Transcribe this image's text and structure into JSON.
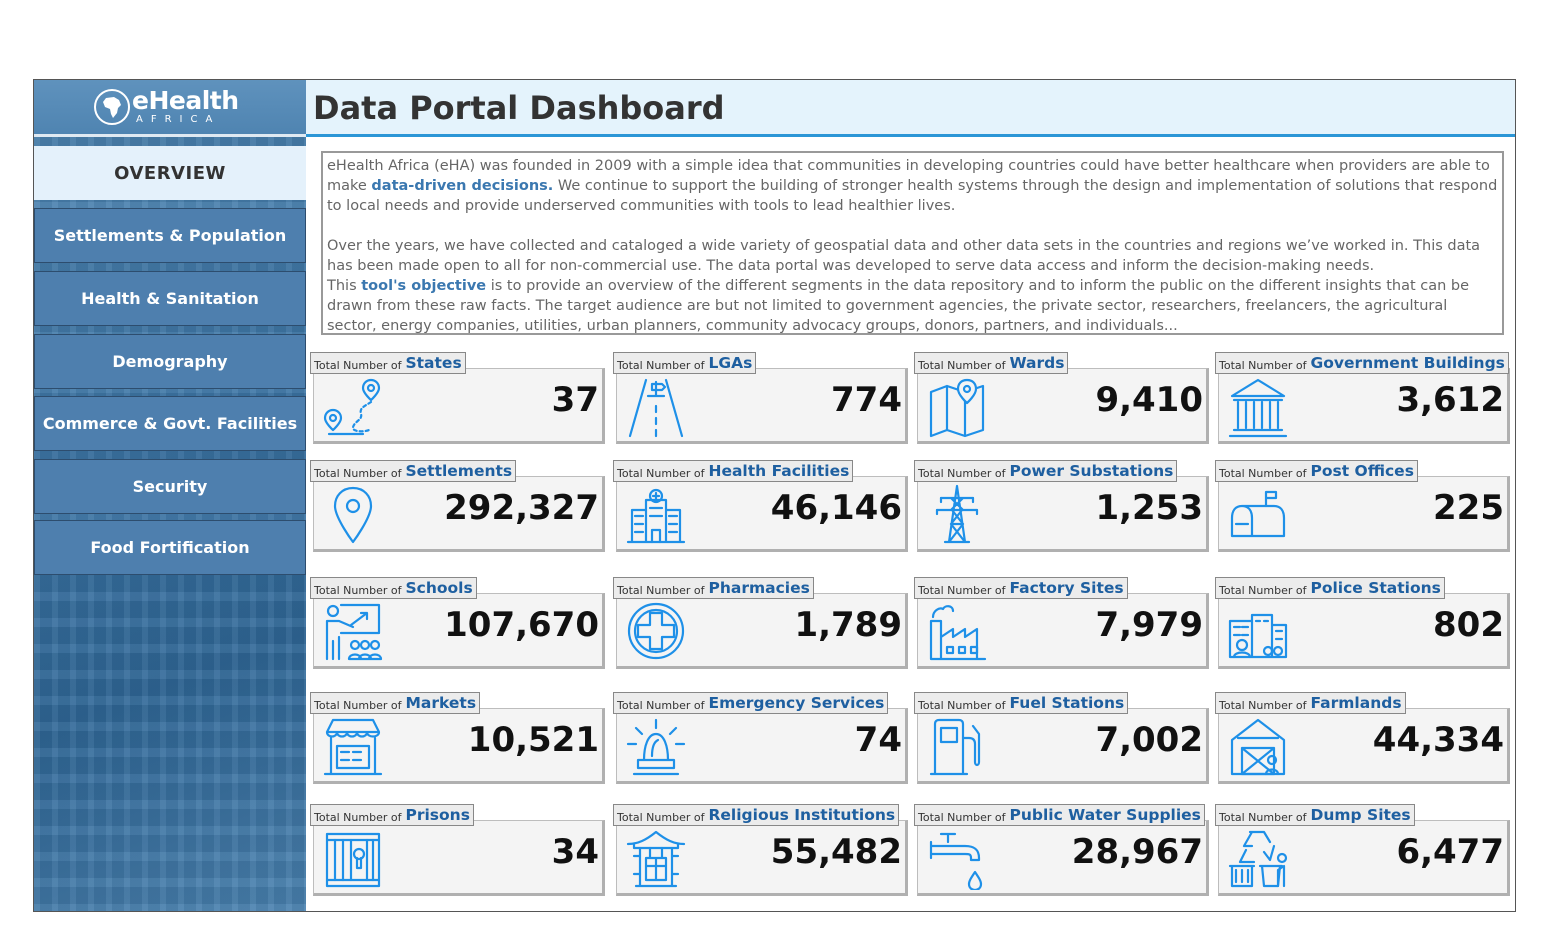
{
  "logo": {
    "main": "eHealth",
    "sub": "AFRICA"
  },
  "header": {
    "title": "Data Portal Dashboard"
  },
  "nav": {
    "overview": "OVERVIEW",
    "items": [
      "Settlements & Population",
      "Health & Sanitation",
      "Demography",
      "Commerce & Govt. Facilities",
      "Security",
      "Food Fortification"
    ]
  },
  "description": {
    "p1_a": "eHealth Africa (eHA) was founded in 2009 with a simple idea that communities in developing countries could have better healthcare when providers are able to make ",
    "p1_hl": "data-driven decisions.",
    "p1_b": " We continue to support the building of stronger health systems through the design and implementation of solutions that respond to local needs and provide underserved communities with tools to lead healthier lives.",
    "p2": "Over the years, we have collected and cataloged a wide variety of geospatial data and other data sets in the countries and regions we’ve worked in. This data has been made open to all for non-commercial use. The data portal was developed to serve data access and inform the decision-making needs.",
    "p3_a": "This ",
    "p3_hl": "tool's objective",
    "p3_b": " is to provide an overview of the different segments in the data repository and to inform the public on the different insights that can be drawn from these raw facts. The target audience are but not limited to government agencies, the private sector, researchers, freelancers, the agricultural sector, energy companies, utilities, urban planners, community advocacy groups, donors, partners, and individuals..."
  },
  "card_prefix": "Total Number of",
  "cards": [
    {
      "name": "States",
      "value": "37",
      "icon": "map-route-icon"
    },
    {
      "name": "LGAs",
      "value": "774",
      "icon": "road-sign-icon"
    },
    {
      "name": "Wards",
      "value": "9,410",
      "icon": "folded-map-icon"
    },
    {
      "name": "Government Buildings",
      "value": "3,612",
      "icon": "government-building-icon"
    },
    {
      "name": "Settlements",
      "value": "292,327",
      "icon": "location-pin-icon"
    },
    {
      "name": "Health Facilities",
      "value": "46,146",
      "icon": "hospital-icon"
    },
    {
      "name": "Power Substations",
      "value": "1,253",
      "icon": "power-tower-icon"
    },
    {
      "name": "Post Offices",
      "value": "225",
      "icon": "mailbox-icon"
    },
    {
      "name": "Schools",
      "value": "107,670",
      "icon": "classroom-icon"
    },
    {
      "name": "Pharmacies",
      "value": "1,789",
      "icon": "medical-cross-icon"
    },
    {
      "name": "Factory Sites",
      "value": "7,979",
      "icon": "factory-icon"
    },
    {
      "name": "Police Stations",
      "value": "802",
      "icon": "police-station-icon"
    },
    {
      "name": "Markets",
      "value": "10,521",
      "icon": "market-stall-icon"
    },
    {
      "name": "Emergency Services",
      "value": "74",
      "icon": "siren-icon"
    },
    {
      "name": "Fuel Stations",
      "value": "7,002",
      "icon": "fuel-pump-icon"
    },
    {
      "name": "Farmlands",
      "value": "44,334",
      "icon": "barn-icon"
    },
    {
      "name": "Prisons",
      "value": "34",
      "icon": "prison-bars-icon"
    },
    {
      "name": "Religious Institutions",
      "value": "55,482",
      "icon": "temple-icon"
    },
    {
      "name": "Public Water Supplies",
      "value": "28,967",
      "icon": "water-tap-icon"
    },
    {
      "name": "Dump Sites",
      "value": "6,477",
      "icon": "recycling-bins-icon"
    }
  ]
}
